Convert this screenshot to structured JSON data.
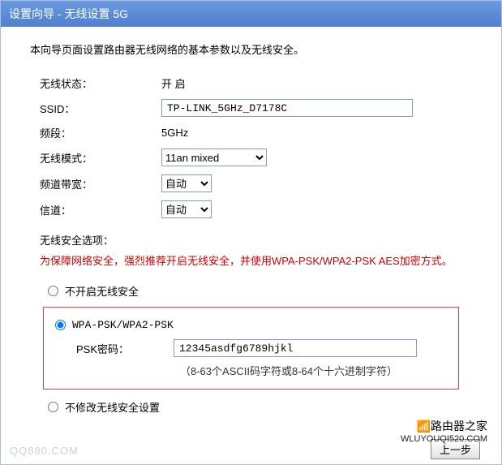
{
  "title": "设置向导 - 无线设置 5G",
  "intro": "本向导页面设置路由器无线网络的基本参数以及无线安全。",
  "wireless": {
    "status_label": "无线状态：",
    "status_value": "开 启",
    "ssid_label": "SSID：",
    "ssid_value": "TP-LINK_5GHz_D7178C",
    "band_label": "频段：",
    "band_value": "5GHz",
    "mode_label": "无线模式：",
    "mode_value": "11an mixed",
    "bandwidth_label": "频道带宽：",
    "bandwidth_value": "自动",
    "channel_label": "信道：",
    "channel_value": "自动"
  },
  "security": {
    "heading": "无线安全选项：",
    "warning": "为保障网络安全，强烈推荐开启无线安全，并使用WPA-PSK/WPA2-PSK AES加密方式。",
    "opt_none": "不开启无线安全",
    "opt_wpa": "WPA-PSK/WPA2-PSK",
    "opt_nochange": "不修改无线安全设置",
    "psk_label": "PSK密码：",
    "psk_value": "12345asdfg6789hjkl",
    "psk_hint": "（8-63个ASCII码字符或8-64个十六进制字符）"
  },
  "footer": {
    "back_btn": "上一步"
  },
  "watermark": {
    "left": "QQ880.COM",
    "right_brand": "路由器之家",
    "right_url": "WLUYOUQI520.COM"
  }
}
